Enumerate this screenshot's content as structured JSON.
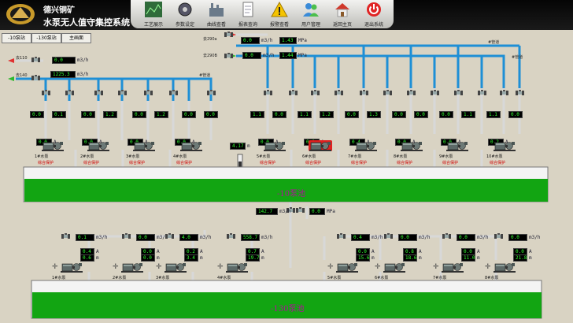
{
  "company": "德兴铜矿",
  "system_title": "水泵无人值守集控系统",
  "toolbar": [
    {
      "label": "工艺展示",
      "icon": "process-map-icon"
    },
    {
      "label": "参数设定",
      "icon": "gear-settings-icon"
    },
    {
      "label": "曲线查看",
      "icon": "factory-trend-icon"
    },
    {
      "label": "报表查询",
      "icon": "report-document-icon"
    },
    {
      "label": "报警查看",
      "icon": "warning-triangle-icon"
    },
    {
      "label": "用户管理",
      "icon": "users-icon"
    },
    {
      "label": "返回主页",
      "icon": "home-icon"
    },
    {
      "label": "退出系统",
      "icon": "power-icon"
    }
  ],
  "nav": [
    "-10泵站",
    "-130泵站",
    "主画面"
  ],
  "colors": {
    "pool": "#12a512",
    "pool_text": "#b0109a",
    "pipe": "#1e8fd6",
    "status": "#d00000",
    "counter_text": "#33ff33",
    "highlight_pump": "#e02020"
  },
  "outlets": {
    "left": [
      {
        "label": "去110"
      },
      {
        "label": "去140"
      }
    ],
    "right": [
      {
        "label": "去290a"
      },
      {
        "label": "去290B"
      }
    ]
  },
  "header_counters": [
    {
      "value": "0.0",
      "unit": "m3/h"
    },
    {
      "value": "1225.3",
      "unit": "m3/h"
    },
    {
      "value": "0.0",
      "unit": "m3/h"
    },
    {
      "value": "1.43",
      "unit": "MPa"
    },
    {
      "value": "0.0",
      "unit": "m3/h"
    },
    {
      "value": "1.44",
      "unit": "MPa"
    }
  ],
  "pipe_labels": [
    "#管道",
    "#管道",
    "#管道"
  ],
  "top_readings": [
    {
      "a": "0.0",
      "b": "0.1"
    },
    {
      "a": "0.0",
      "b": "1.2"
    },
    {
      "a": "0.0",
      "b": "1.2"
    },
    {
      "a": "0.0",
      "b": "0.0"
    },
    {
      "a": "1.1",
      "b": "0.0"
    },
    {
      "a": "1.1",
      "b": "1.2"
    },
    {
      "a": "0.0",
      "b": "1.3"
    },
    {
      "a": "0.0",
      "b": "1.2"
    },
    {
      "a": "1.2",
      "b": "0.0"
    },
    {
      "a": "1.2",
      "b": "0.0"
    },
    {
      "a": "0.0",
      "b": "0.0"
    },
    {
      "a": "0.0",
      "b": "1.1"
    },
    {
      "a": "1.1",
      "b": "0.0"
    }
  ],
  "level_value": "4.17",
  "level_unit": "m",
  "top_pumps": [
    {
      "name": "1#水泵",
      "status": "综合保护",
      "current": "0.0"
    },
    {
      "name": "2#水泵",
      "status": "综合保护",
      "current": "0.0"
    },
    {
      "name": "3#水泵",
      "status": "综合保护",
      "current": "0.0"
    },
    {
      "name": "4#水泵",
      "status": "综合保护",
      "current": "0.0"
    },
    {
      "name": "5#水泵",
      "status": "综合保护",
      "current": "0.0"
    },
    {
      "name": "6#水泵",
      "status": "综合保护",
      "current": "0.0"
    },
    {
      "name": "7#水泵",
      "status": "综合保护",
      "current": "0.4"
    },
    {
      "name": "8#水泵",
      "status": "综合保护",
      "current": "0.0"
    },
    {
      "name": "9#水泵",
      "status": "综合保护",
      "current": "0.0"
    },
    {
      "name": "10#水泵",
      "status": "综合保护",
      "current": "0.2"
    }
  ],
  "pool1": "-10泵池",
  "pool2": "-130泵池",
  "transfer": [
    {
      "value": "142.7",
      "unit": "m3/h"
    },
    {
      "value": "0.0",
      "unit": "MPa"
    }
  ],
  "bottom_groups": [
    {
      "flow": "0.1",
      "r1": "0.4",
      "r2": "0.6",
      "pump": "1#水泵"
    },
    {
      "flow": "0.0",
      "r1": "0.0",
      "r2": "0.0",
      "pump": "2#水泵"
    },
    {
      "flow": "4.0",
      "r1": "0.2",
      "r2": "3.4",
      "pump": "3#水泵"
    },
    {
      "flow": "558.7",
      "r1": "0.7",
      "r2": "19.7",
      "pump": "4#水泵"
    },
    {
      "flow": "0.4",
      "r1": "0.0",
      "r2": "15.6",
      "pump": "5#水泵"
    },
    {
      "flow": "0.0",
      "r1": "0.8",
      "r2": "18.6",
      "pump": "6#水泵"
    },
    {
      "flow": "0.0",
      "r1": "0.0",
      "r2": "11.0",
      "pump": "7#水泵"
    },
    {
      "flow": "0.0",
      "r1": "0.0",
      "r2": "21.8",
      "pump": "8#水泵"
    }
  ]
}
